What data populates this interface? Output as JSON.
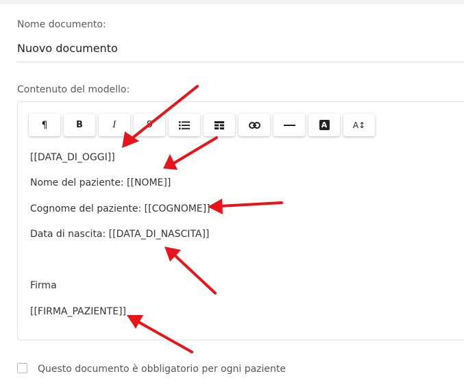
{
  "form": {
    "name_label": "Nome documento:",
    "name_value": "Nuovo documento",
    "content_label": "Contenuto del modello:",
    "checkbox_label": "Questo documento è obbligatorio per ogni paziente",
    "checkbox_checked": false
  },
  "toolbar": {
    "paragraph_glyph": "¶",
    "bold_glyph": "B",
    "italic_glyph": "I",
    "strikethrough_glyph": "S",
    "list_icon": "list-icon",
    "table_icon": "table-icon",
    "link_icon": "link-icon",
    "horizontal_rule_icon": "horizontal-rule-icon",
    "text_color_glyph": "A",
    "font_size_glyph": "A↕"
  },
  "editor": {
    "lines": [
      "[[DATA_DI_OGGI]]",
      "Nome del paziente: [[NOME]]",
      "Cognome del paziente: [[COGNOME]]",
      "Data di nascita: [[DATA_DI_NASCITA]]",
      "",
      "Firma",
      "[[FIRMA_PAZIENTE]]"
    ]
  },
  "annotations": {
    "arrow_color": "#e8141a"
  }
}
